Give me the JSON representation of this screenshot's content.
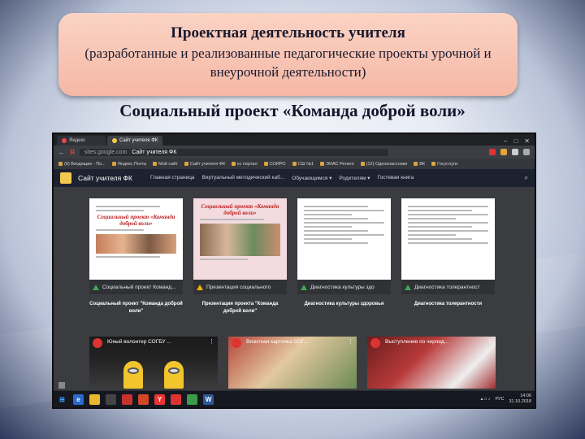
{
  "slide": {
    "title_main": "Проектная деятельность учителя",
    "title_sub": "(разработанные и реализованные педагогические проекты урочной и внеурочной деятельности)",
    "subtitle": "Социальный проект «Команда доброй воли»"
  },
  "browser": {
    "tabs": [
      {
        "label": "Яндекс",
        "active": false
      },
      {
        "label": "Сайт учителя ФК",
        "active": true
      }
    ],
    "address": {
      "brand": "Я",
      "domain": "sites.google.com",
      "page_title": "Сайт учителя ФК"
    },
    "bookmarks": [
      "(6) Входящие - По...",
      "Яндекс.Почта",
      "Мой сайт",
      "Сайт учителя ФК",
      "кс портал",
      "СОИРО",
      "СШ №1",
      "ЭИАС Регион",
      "(12) Одноклассники",
      "ВК",
      "Госуслуги"
    ]
  },
  "site": {
    "title": "Сайт учителя ФК",
    "nav": [
      "Главная страница",
      "Виртуальный методический каб...",
      "Обучающимся ▾",
      "Родителям ▾",
      "Гостевая книга"
    ]
  },
  "documents": [
    {
      "file_name": "Социальный проект Команд...",
      "label": "Социальный проект \"Команда доброй воли\"",
      "thumb_heading": "Социальный проект «Команда доброй воли»"
    },
    {
      "file_name": "Презентация социального",
      "label": "Презентация проекта \"Команда доброй воли\"",
      "thumb_heading": "Социальный проект «Команда доброй воли»"
    },
    {
      "file_name": "Диагностика культуры здо",
      "label": "Диагностика культуры здоровья",
      "thumb_heading": ""
    },
    {
      "file_name": "Диагностика толерантност",
      "label": "Диагностика толерантности",
      "thumb_heading": ""
    }
  ],
  "videos": [
    {
      "title": "Юный волонтер СОГБУ ..."
    },
    {
      "title": "Визитная карточка СОГ..."
    },
    {
      "title": "Выступление по черлид..."
    }
  ],
  "taskbar": {
    "lang": "РУС",
    "time": "14:06",
    "date": "31.10.2018"
  }
}
